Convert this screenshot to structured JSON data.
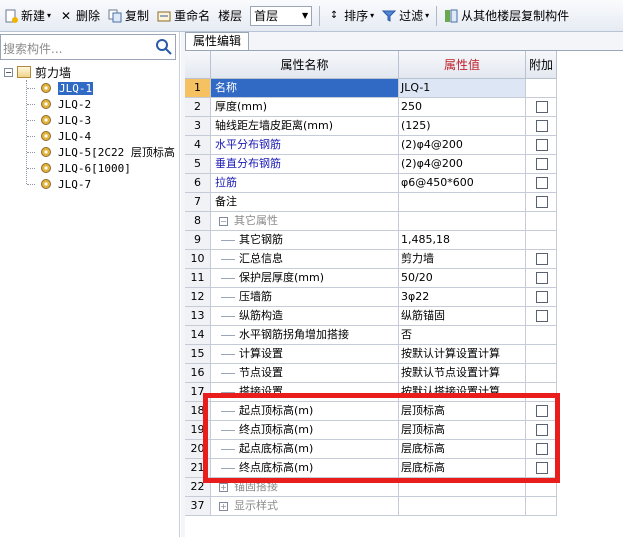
{
  "toolbar": {
    "new_label": "新建",
    "delete_label": "删除",
    "copy_label": "复制",
    "rename_label": "重命名",
    "floor_label": "楼层",
    "floor_value": "首层",
    "sort_label": "排序",
    "filter_label": "过滤",
    "copy_from_other_floor_label": "从其他楼层复制构件"
  },
  "search": {
    "placeholder": "搜索构件..."
  },
  "tree": {
    "root_label": "剪力墙",
    "items": [
      {
        "label": "JLQ-1",
        "selected": true
      },
      {
        "label": "JLQ-2"
      },
      {
        "label": "JLQ-3"
      },
      {
        "label": "JLQ-4"
      },
      {
        "label": "JLQ-5[2C22 层顶标高"
      },
      {
        "label": "JLQ-6[1000]"
      },
      {
        "label": "JLQ-7"
      }
    ]
  },
  "panel": {
    "tab_label": "属性编辑",
    "headers": {
      "name": "属性名称",
      "value": "属性值",
      "add": "附加"
    },
    "rows": [
      {
        "num": "1",
        "name": "名称",
        "value": "JLQ-1",
        "check": false,
        "style": "blue",
        "selected": true
      },
      {
        "num": "2",
        "name": "厚度(mm)",
        "value": "250",
        "check": true
      },
      {
        "num": "3",
        "name": "轴线距左墙皮距离(mm)",
        "value": "(125)",
        "check": true
      },
      {
        "num": "4",
        "name": "水平分布钢筋",
        "value": "(2)φ4@200",
        "check": true,
        "style": "blue"
      },
      {
        "num": "5",
        "name": "垂直分布钢筋",
        "value": "(2)φ4@200",
        "check": true,
        "style": "blue"
      },
      {
        "num": "6",
        "name": "拉筋",
        "value": "φ6@450*600",
        "check": true,
        "style": "blue"
      },
      {
        "num": "7",
        "name": "备注",
        "value": "",
        "check": true
      },
      {
        "num": "8",
        "name": "其它属性",
        "value": "",
        "check": false,
        "style": "group"
      },
      {
        "num": "9",
        "name": "其它钢筋",
        "value": "1,485,18",
        "check": false,
        "indent": true
      },
      {
        "num": "10",
        "name": "汇总信息",
        "value": "剪力墙",
        "check": true,
        "indent": true
      },
      {
        "num": "11",
        "name": "保护层厚度(mm)",
        "value": "50/20",
        "check": true,
        "indent": true
      },
      {
        "num": "12",
        "name": "压墙筋",
        "value": "3φ22",
        "check": true,
        "indent": true
      },
      {
        "num": "13",
        "name": "纵筋构造",
        "value": "纵筋锚固",
        "check": true,
        "indent": true
      },
      {
        "num": "14",
        "name": "水平钢筋拐角增加搭接",
        "value": "否",
        "check": false,
        "indent": true
      },
      {
        "num": "15",
        "name": "计算设置",
        "value": "按默认计算设置计算",
        "check": false,
        "indent": true
      },
      {
        "num": "16",
        "name": "节点设置",
        "value": "按默认节点设置计算",
        "check": false,
        "indent": true
      },
      {
        "num": "17",
        "name": "搭接设置",
        "value": "按默认搭接设置计算",
        "check": false,
        "indent": true
      },
      {
        "num": "18",
        "name": "起点顶标高(m)",
        "value": "层顶标高",
        "check": true,
        "indent": true
      },
      {
        "num": "19",
        "name": "终点顶标高(m)",
        "value": "层顶标高",
        "check": true,
        "indent": true
      },
      {
        "num": "20",
        "name": "起点底标高(m)",
        "value": "层底标高",
        "check": true,
        "indent": true
      },
      {
        "num": "21",
        "name": "终点底标高(m)",
        "value": "层底标高",
        "check": true,
        "indent": true
      },
      {
        "num": "22",
        "name": "锚固搭接",
        "value": "",
        "check": false,
        "style": "group-plus"
      },
      {
        "num": "37",
        "name": "显示样式",
        "value": "",
        "check": false,
        "style": "group-plus"
      }
    ]
  },
  "colors": {
    "highlight": "#ea1d1d",
    "selection": "#316ac5",
    "link_text": "#1a1ab4"
  }
}
